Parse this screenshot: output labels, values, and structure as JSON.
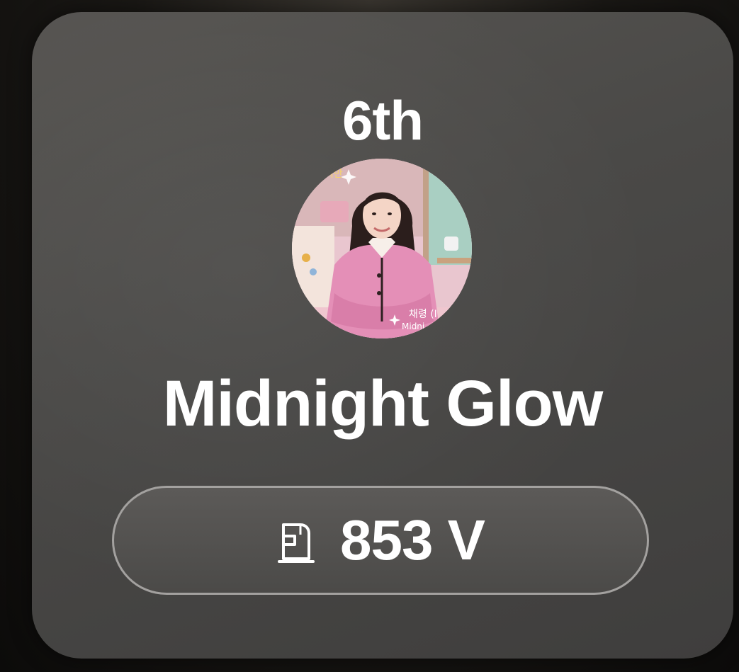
{
  "card": {
    "rank": "6th",
    "name": "Midnight Glow",
    "avatar": {
      "icon": "profile-photo",
      "overlay_text": "채령 (I"
    },
    "votes": {
      "icon": "vote-hand-icon",
      "value": "853 V"
    }
  },
  "colors": {
    "card_background": "#4a4947",
    "text": "#ffffff",
    "pill_border": "#a3a19f"
  }
}
